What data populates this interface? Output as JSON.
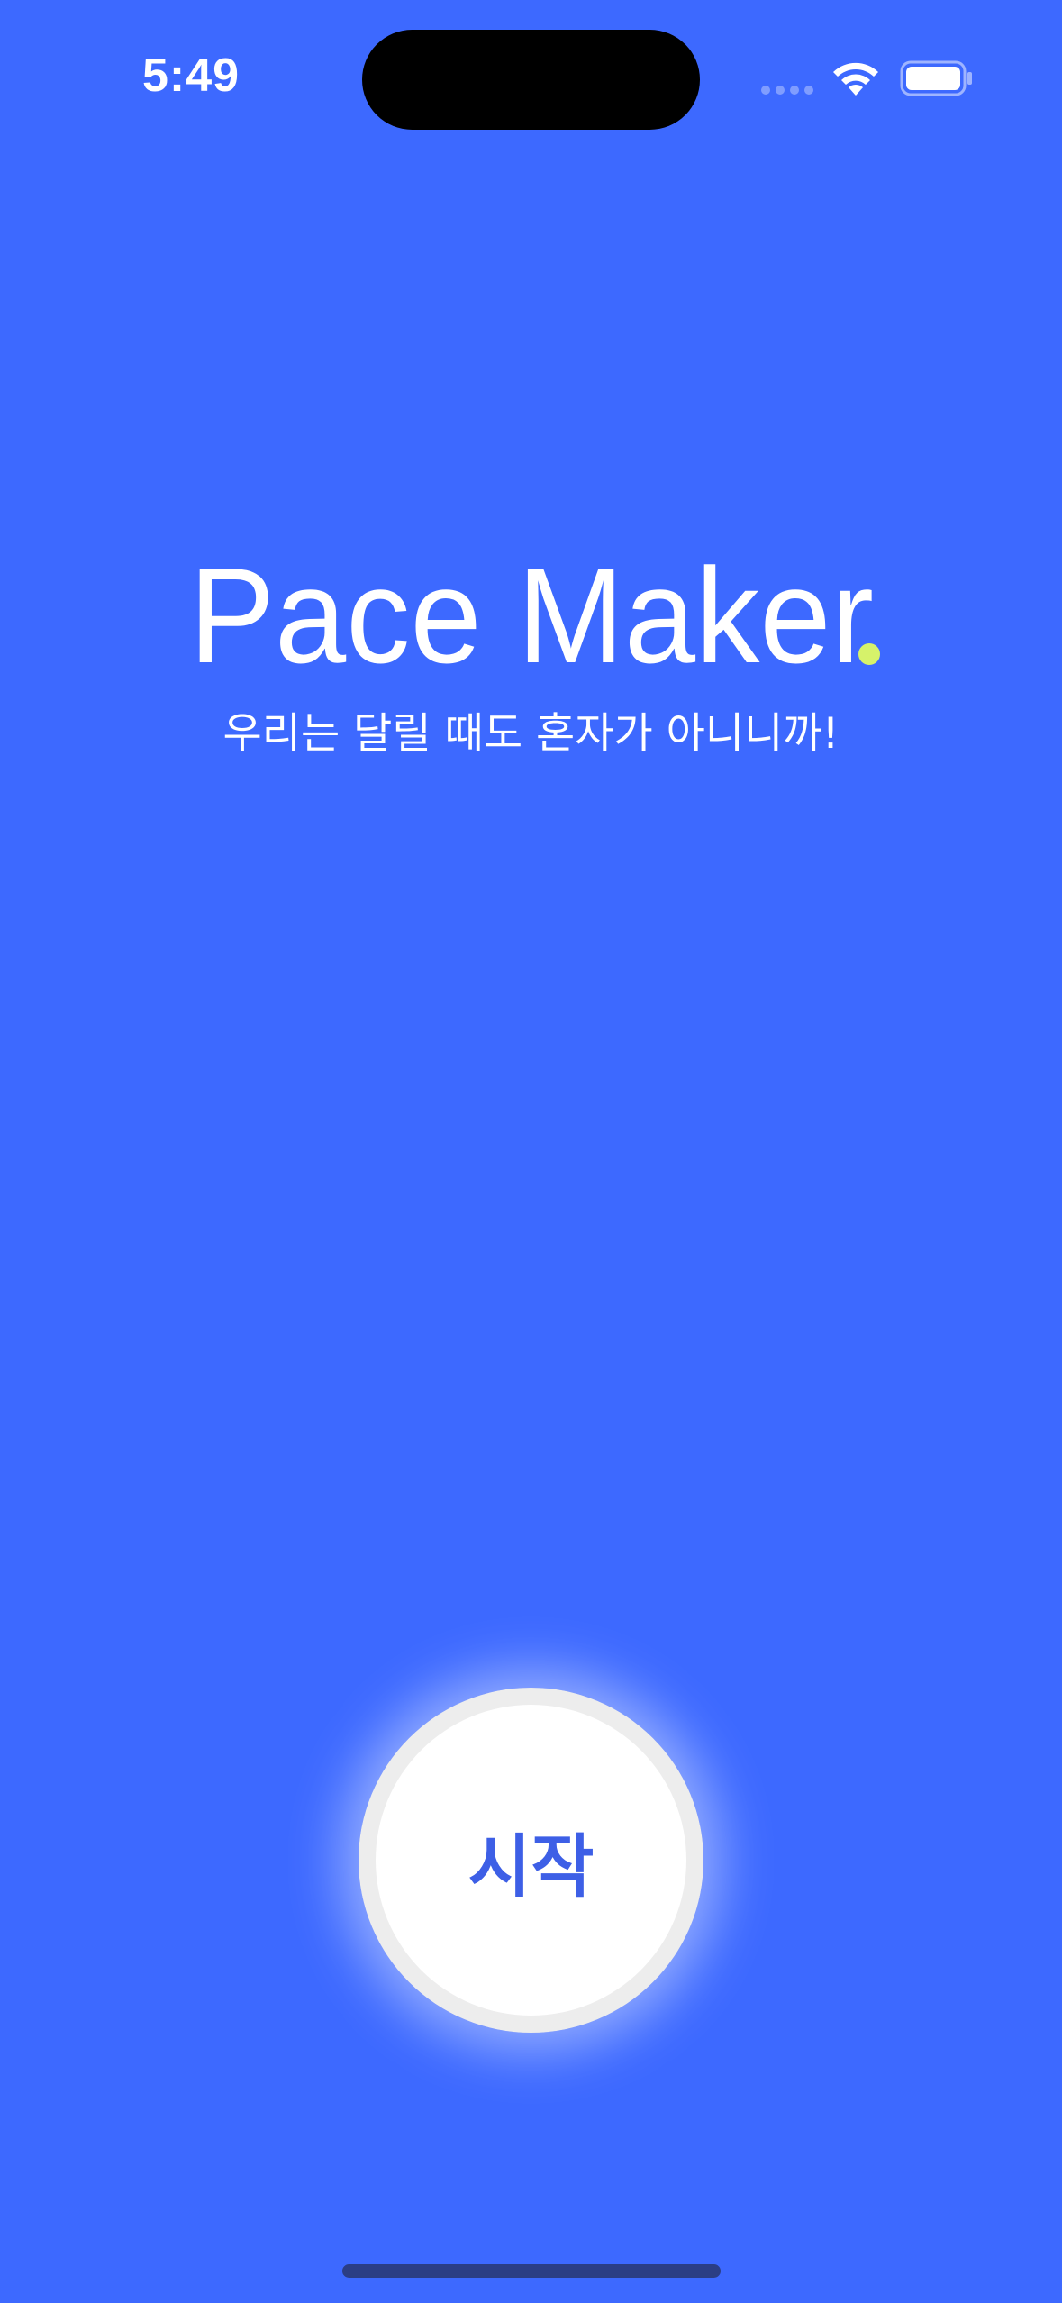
{
  "status_bar": {
    "time": "5:49",
    "wifi_icon": "wifi-icon",
    "battery_icon": "battery-icon",
    "signal_icon": "cellular-signal-icon"
  },
  "logo": {
    "text": "Pace Maker.",
    "accent_color": "#D6F26A"
  },
  "tagline": "우리는 달릴 때도 혼자가 아니니까!",
  "start_button": {
    "label": "시작"
  },
  "colors": {
    "background": "#3D69FF",
    "button_text": "#3D5FE6"
  }
}
